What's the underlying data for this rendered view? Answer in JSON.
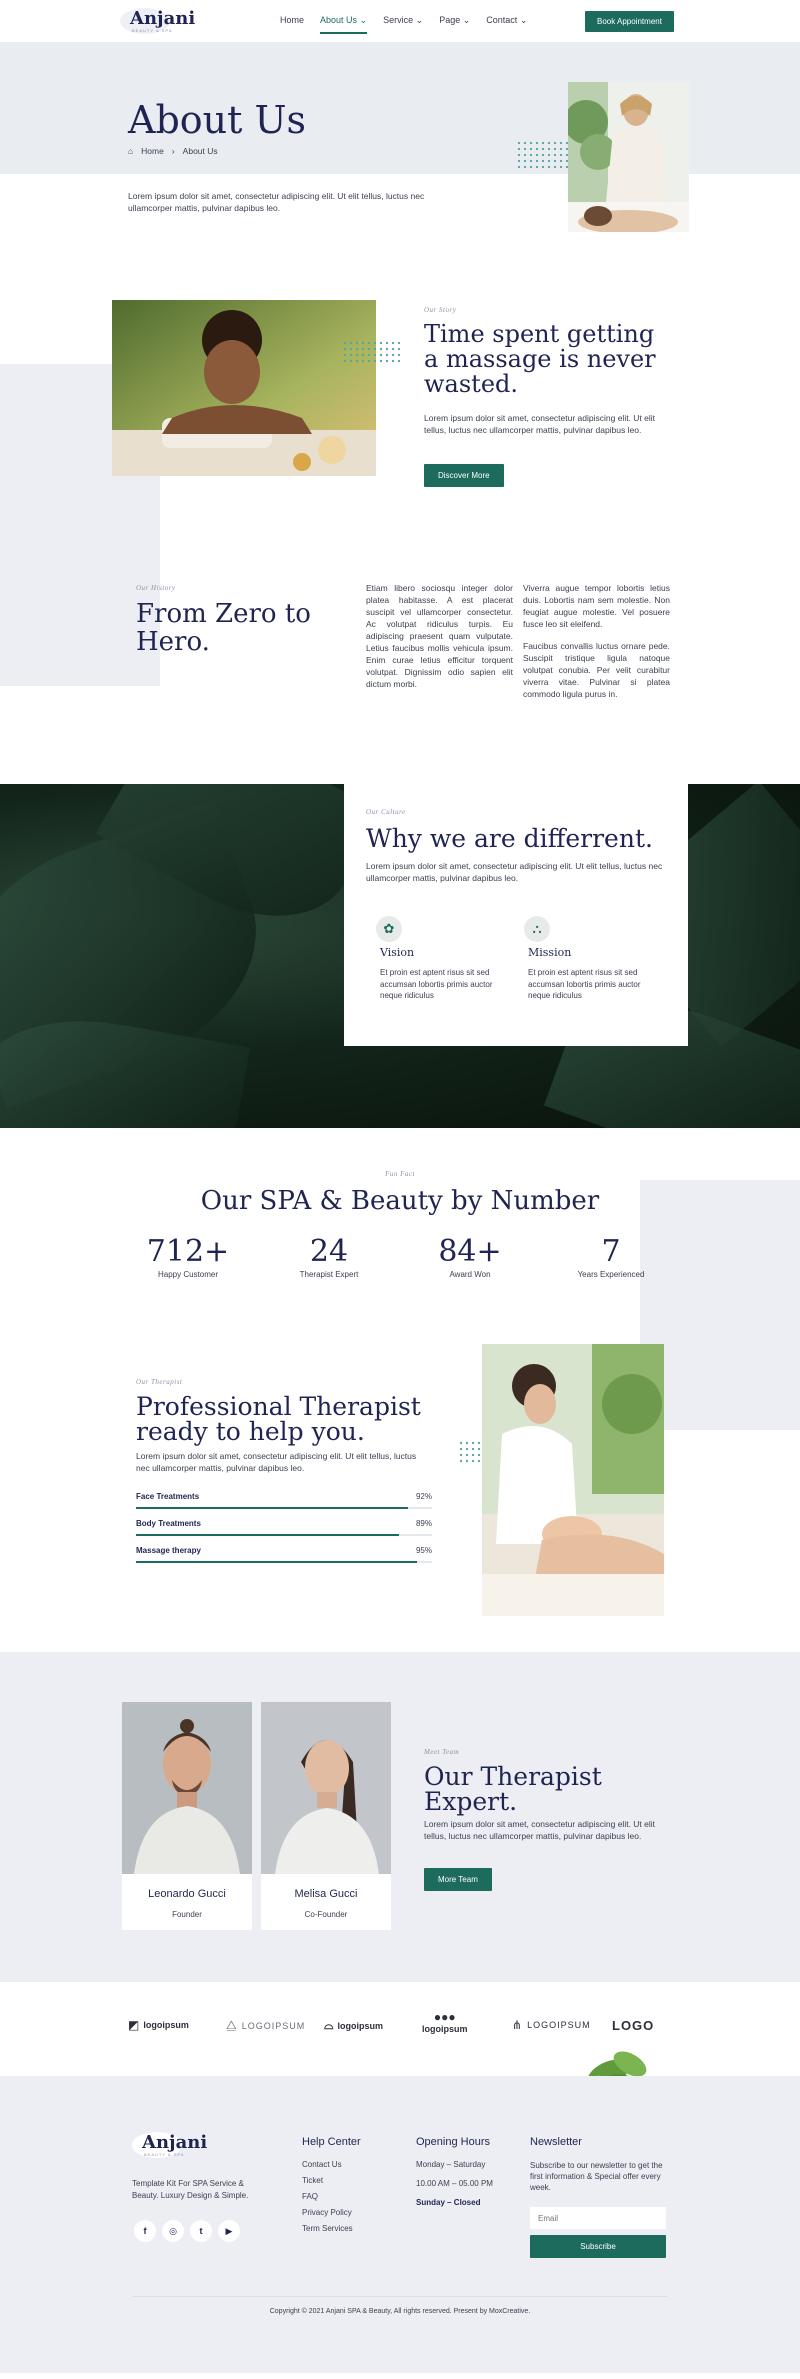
{
  "header": {
    "logo_text": "Anjani",
    "logo_sub": "BEAUTY & SPA",
    "nav": [
      "Home",
      "About Us",
      "Service",
      "Page",
      "Contact"
    ],
    "cta": "Book Appointment"
  },
  "hero": {
    "title": "About Us",
    "breadcrumb": [
      "Home",
      "About Us"
    ],
    "text": "Lorem ipsum dolor sit amet, consectetur adipiscing elit. Ut elit tellus, luctus nec ullamcorper mattis, pulvinar dapibus leo."
  },
  "story": {
    "eyebrow": "Our Story",
    "title": "Time spent getting a massage is never wasted.",
    "text": "Lorem ipsum dolor sit amet, consectetur adipiscing elit. Ut elit tellus, luctus nec ullamcorper mattis, pulvinar dapibus leo.",
    "button": "Discover More"
  },
  "history": {
    "eyebrow": "Our History",
    "title": "From Zero to Hero.",
    "col1": "Etiam libero sociosqu integer dolor platea habitasse. A est placerat suscipit vel ullamcorper consectetur. Ac volutpat ridiculus turpis. Eu adipiscing praesent quam vulputate. Letius faucibus mollis vehicula ipsum. Enim curae letius efficitur torquent volutpat. Dignissim odio sapien elit dictum morbi.",
    "col2a": "Viverra augue tempor lobortis letius duis. Lobortis nam sem molestie. Non feugiat augue molestie. Vel posuere fusce leo sit eleifend.",
    "col2b": "Faucibus convallis luctus ornare pede. Suscipit tristique ligula natoque volutpat conubia. Per velit curabitur viverra vitae. Pulvinar si platea commodo ligula purus in."
  },
  "culture": {
    "eyebrow": "Our Culture",
    "title": "Why we are differrent.",
    "text": "Lorem ipsum dolor sit amet, consectetur adipiscing elit. Ut elit tellus, luctus nec ullamcorper mattis, pulvinar dapibus leo.",
    "features": [
      {
        "title": "Vision",
        "icon": "lotus-icon",
        "text": "Et proin est aptent risus sit sed accumsan lobortis primis auctor neque ridiculus"
      },
      {
        "title": "Mission",
        "icon": "stones-icon",
        "text": "Et proin est aptent risus sit sed accumsan lobortis primis auctor neque ridiculus"
      }
    ]
  },
  "numbers": {
    "eyebrow": "Fun Fact",
    "title": "Our SPA & Beauty by Number",
    "stats": [
      {
        "value": "712+",
        "label": "Happy Customer"
      },
      {
        "value": "24",
        "label": "Therapist Expert"
      },
      {
        "value": "84+",
        "label": "Award Won"
      },
      {
        "value": "7",
        "label": "Years Experienced"
      }
    ]
  },
  "skills": {
    "eyebrow": "Our Therapist",
    "title": "Professional Therapist ready to help you.",
    "text": "Lorem ipsum dolor sit amet, consectetur adipiscing elit. Ut elit tellus, luctus nec ullamcorper mattis, pulvinar dapibus leo.",
    "bars": [
      {
        "label": "Face Treatments",
        "percent": 92
      },
      {
        "label": "Body Treatments",
        "percent": 89
      },
      {
        "label": "Massage therapy",
        "percent": 95
      }
    ]
  },
  "team": {
    "members": [
      {
        "name": "Leonardo Gucci",
        "role": "Founder"
      },
      {
        "name": "Melisa Gucci",
        "role": "Co-Founder"
      }
    ],
    "eyebrow": "Meet Team",
    "title": "Our Therapist Expert.",
    "text": "Lorem ipsum dolor sit amet, consectetur adipiscing elit. Ut elit tellus, luctus nec ullamcorper mattis, pulvinar dapibus leo.",
    "button": "More Team"
  },
  "logos": [
    "logoipsum",
    "LOGOIPSUM",
    "logoipsum",
    "logoipsum",
    "LOGOIPSUM",
    "LOGO"
  ],
  "footer": {
    "logo_text": "Anjani",
    "logo_sub": "BEAUTY & SPA",
    "tagline": "Template Kit For SPA Service & Beauty. Luxury Design & Simple.",
    "socials": [
      "facebook-icon",
      "instagram-icon",
      "twitter-icon",
      "youtube-icon"
    ],
    "help_title": "Help Center",
    "help_links": [
      "Contact Us",
      "Ticket",
      "FAQ",
      "Privacy Policy",
      "Term Services"
    ],
    "hours_title": "Opening Hours",
    "hours_days": "Monday – Saturday",
    "hours_time": "10.00 AM – 05.00 PM",
    "hours_closed": "Sunday – Closed",
    "news_title": "Newsletter",
    "news_text": "Subscribe to our newsletter to get the first information & Special offer every week.",
    "email_placeholder": "Email",
    "subscribe": "Subscribe",
    "copyright": "Copyright © 2021 Anjani SPA & Beauty, All rights reserved. Present by MoxCreative."
  }
}
